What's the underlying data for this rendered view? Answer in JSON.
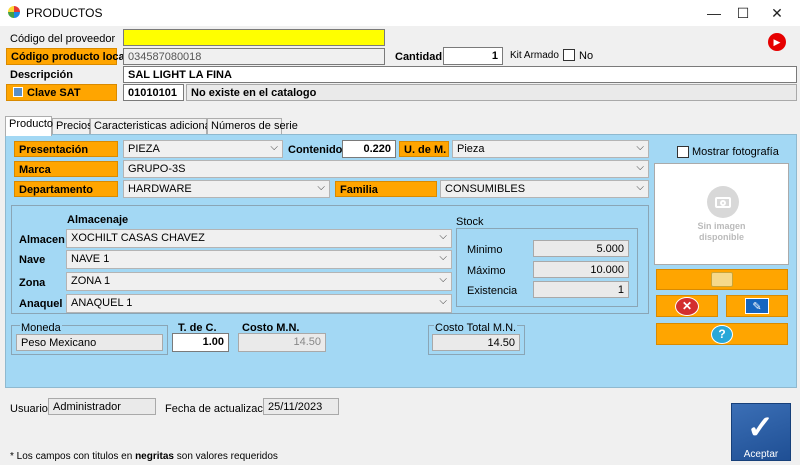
{
  "window": {
    "title": "PRODUCTOS",
    "minimize": "—",
    "maximize": "☐",
    "close": "✕"
  },
  "form": {
    "codigo_proveedor_label": "Código del proveedor",
    "codigo_proveedor_value": "",
    "codigo_local_label": "Código producto local",
    "codigo_local_value": "034587080018",
    "cantidad_label": "Cantidad",
    "cantidad_value": "1",
    "kit_armado_label": "Kit Armado",
    "kit_no_label": "No",
    "descripcion_label": "Descripción",
    "descripcion_value": "SAL LIGHT LA FINA",
    "clave_sat_label": "Clave SAT",
    "clave_sat_code": "01010101",
    "clave_sat_desc": "No existe en el catalogo"
  },
  "tabs": [
    {
      "label": "Producto"
    },
    {
      "label": "Precios"
    },
    {
      "label": "Caracteristicas adicionales"
    },
    {
      "label": "Números de serie"
    }
  ],
  "producto": {
    "presentacion_label": "Presentación",
    "presentacion_value": "PIEZA",
    "contenido_label": "Contenido",
    "contenido_value": "0.220",
    "udm_label": "U. de M.",
    "udm_value": "Pieza",
    "marca_label": "Marca",
    "marca_value": "GRUPO-3S",
    "departamento_label": "Departamento",
    "departamento_value": "HARDWARE",
    "familia_label": "Familia",
    "familia_value": "CONSUMIBLES",
    "almacenaje_label": "Almacenaje",
    "almacen_label": "Almacen",
    "almacen_value": "XOCHILT CASAS CHAVEZ",
    "nave_label": "Nave",
    "nave_value": "NAVE 1",
    "zona_label": "Zona",
    "zona_value": "ZONA 1",
    "anaquel_label": "Anaquel",
    "anaquel_value": "ANAQUEL 1",
    "stock_label": "Stock",
    "minimo_label": "Minimo",
    "minimo_value": "5.000",
    "maximo_label": "Máximo",
    "maximo_value": "10.000",
    "existencia_label": "Existencia",
    "existencia_value": "1",
    "moneda_label": "Moneda",
    "moneda_value": "Peso Mexicano",
    "tdc_label": "T. de C.",
    "tdc_value": "1.00",
    "costo_mn_label": "Costo M.N.",
    "costo_mn_value": "14.50",
    "costo_total_label": "Costo Total M.N.",
    "costo_total_value": "14.50",
    "mostrar_foto_label": "Mostrar fotografía",
    "sin_imagen_line1": "Sin imagen",
    "sin_imagen_line2": "disponible"
  },
  "footer": {
    "usuario_label": "Usuario",
    "usuario_value": "Administrador",
    "fecha_label": "Fecha de actualizacion",
    "fecha_value": "25/11/2023",
    "note_prefix": "* Los campos con titulos en ",
    "note_bold": "negritas",
    "note_suffix": " son valores requeridos",
    "aceptar_label": "Aceptar"
  },
  "colors": {
    "accent_orange": "#ffa500",
    "panel_blue": "#a3d8f4",
    "required_yellow": "#ffff00"
  }
}
